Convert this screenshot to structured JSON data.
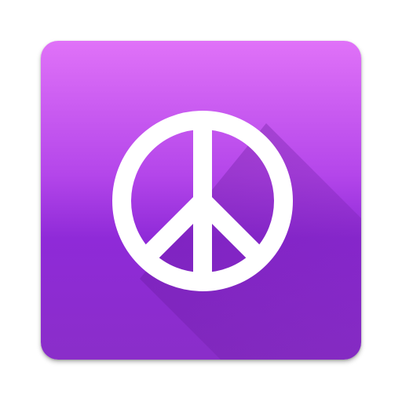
{
  "app": {
    "icon_name": "peace-icon",
    "colors": {
      "gradient_top": "#e072f8",
      "gradient_mid": "#b446ea",
      "gradient_bottom": "#8a2ec9",
      "symbol": "#ffffff",
      "long_shadow": "#6a1f9e"
    }
  }
}
